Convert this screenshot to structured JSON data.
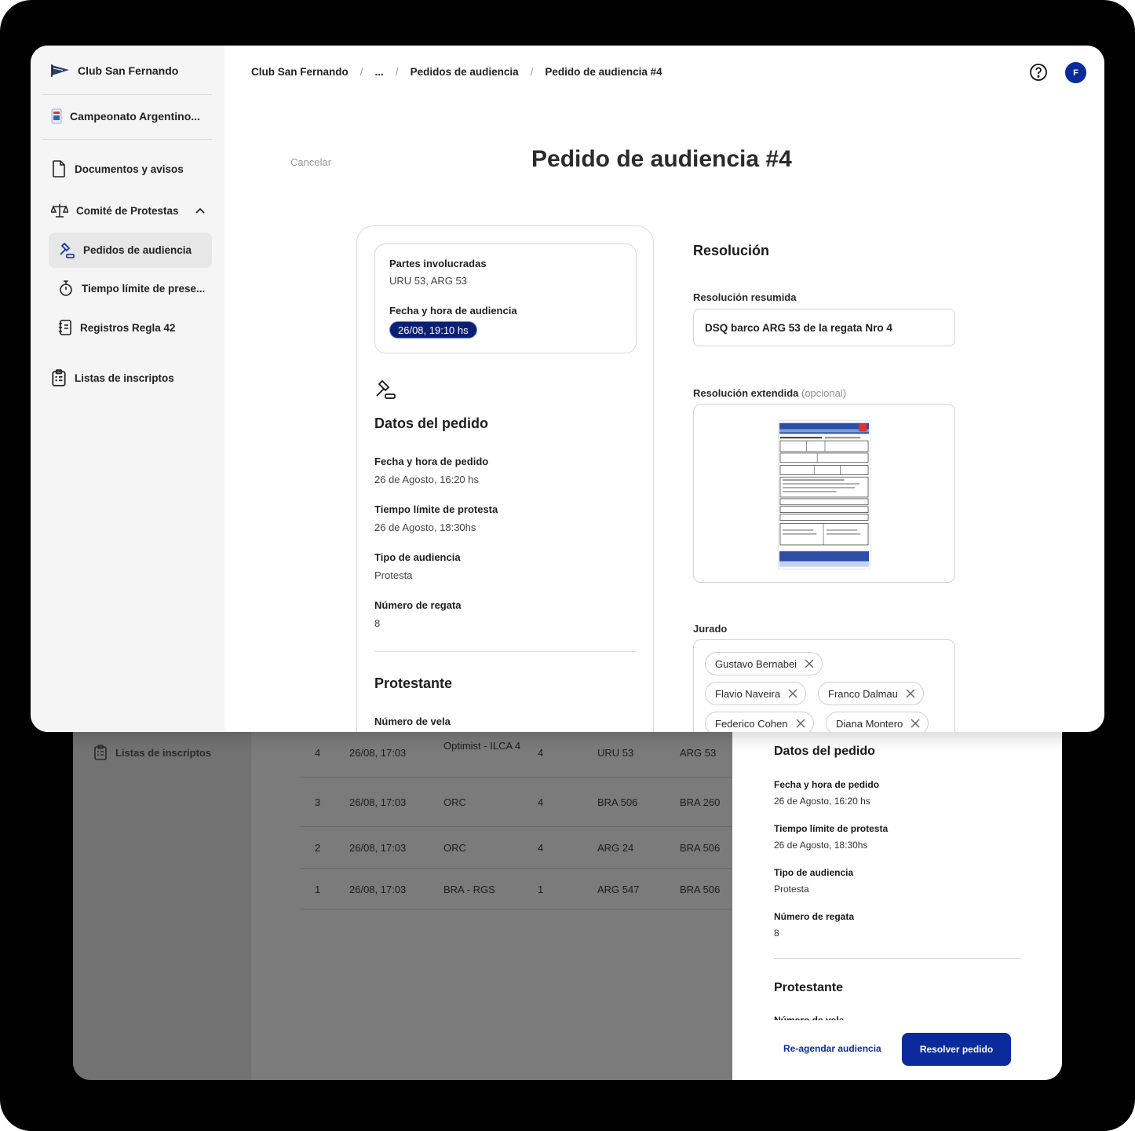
{
  "back_window": {
    "sidebar_item": "Listas de inscriptos",
    "rows": [
      {
        "num": "4",
        "date": "26/08, 17:03",
        "class": "Optimist - ILCA 4",
        "race": "4",
        "protestor": "URU 53",
        "protestee": "ARG 53"
      },
      {
        "num": "3",
        "date": "26/08, 17:03",
        "class": "ORC",
        "race": "4",
        "protestor": "BRA 506",
        "protestee": "BRA 260"
      },
      {
        "num": "2",
        "date": "26/08, 17:03",
        "class": "ORC",
        "race": "4",
        "protestor": "ARG 24",
        "protestee": "BRA 506"
      },
      {
        "num": "1",
        "date": "26/08, 17:03",
        "class": "BRA - RGS",
        "race": "1",
        "protestor": "ARG 547",
        "protestee": "BRA 506"
      }
    ],
    "panel": {
      "title": "Datos del pedido",
      "fields": [
        {
          "label": "Fecha y hora de pedido",
          "value": "26 de Agosto, 16:20 hs"
        },
        {
          "label": "Tiempo límite de protesta",
          "value": "26 de Agosto, 18:30hs"
        },
        {
          "label": "Tipo de audiencia",
          "value": "Protesta"
        },
        {
          "label": "Número de regata",
          "value": "8"
        }
      ],
      "protestante_title": "Protestante",
      "cut_label": "Número de vela",
      "reschedule_label": "Re-agendar audiencia",
      "resolve_label": "Resolver pedido"
    }
  },
  "sidebar": {
    "club": "Club San Fernando",
    "event": "Campeonato Argentino...",
    "documents": "Documentos y avisos",
    "committee": "Comité de Protestas",
    "hearing_requests": "Pedidos de audiencia",
    "time_limit": "Tiempo límite de prese...",
    "rule42": "Registros Regla 42",
    "entries": "Listas de inscriptos"
  },
  "breadcrumb": [
    "Club San Fernando",
    "...",
    "Pedidos de audiencia",
    "Pedido de audiencia #4"
  ],
  "avatar_initial": "F",
  "cancel_label": "Cancelar",
  "page_title": "Pedido de audiencia #4",
  "parties": {
    "label": "Partes involucradas",
    "value": "URU 53, ARG 53",
    "date_label": "Fecha y hora de audiencia",
    "date_value": "26/08, 19:10 hs"
  },
  "request_data": {
    "title": "Datos del pedido",
    "fields": [
      {
        "label": "Fecha y hora de pedido",
        "value": "26 de Agosto, 16:20 hs"
      },
      {
        "label": "Tiempo límite de protesta",
        "value": "26 de Agosto, 18:30hs"
      },
      {
        "label": "Tipo de audiencia",
        "value": "Protesta"
      },
      {
        "label": "Número de regata",
        "value": "8"
      }
    ]
  },
  "protestante": {
    "title": "Protestante",
    "sail_label": "Número de vela"
  },
  "resolution": {
    "title": "Resolución",
    "summary_label": "Resolución resumida",
    "summary_value": "DSQ barco ARG 53 de la regata Nro 4",
    "extended_label": "Resolución extendida",
    "extended_optional": "(opcional)",
    "jury_label": "Jurado",
    "jury": [
      "Gustavo Bernabei",
      "Flavio Naveira",
      "Franco Dalmau",
      "Federico Cohen",
      "Diana Montero"
    ]
  },
  "colors": {
    "primary": "#0b2a9b",
    "pill": "#0b1f73"
  }
}
